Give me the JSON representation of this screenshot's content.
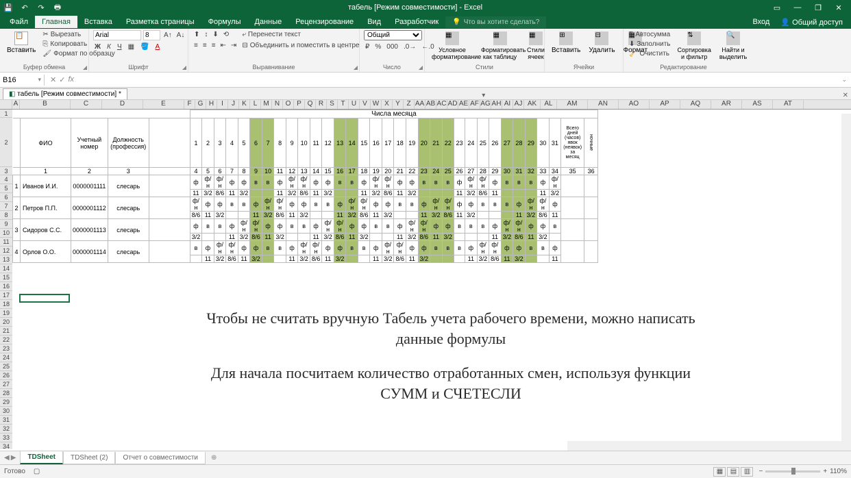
{
  "title": "табель [Режим совместимости] - Excel",
  "menu": {
    "file": "Файл",
    "tabs": [
      "Главная",
      "Вставка",
      "Разметка страницы",
      "Формулы",
      "Данные",
      "Рецензирование",
      "Вид",
      "Разработчик"
    ],
    "tell_me": "Что вы хотите сделать?",
    "login": "Вход",
    "share": "Общий доступ"
  },
  "ribbon": {
    "clipboard": {
      "label": "Буфер обмена",
      "paste": "Вставить",
      "cut": "Вырезать",
      "copy": "Копировать",
      "format_painter": "Формат по образцу"
    },
    "font": {
      "label": "Шрифт",
      "name": "Arial",
      "size": "8"
    },
    "alignment": {
      "label": "Выравнивание",
      "wrap": "Перенести текст",
      "merge": "Объединить и поместить в центре"
    },
    "number": {
      "label": "Число",
      "format": "Общий"
    },
    "styles": {
      "label": "Стили",
      "cond": "Условное форматирование",
      "table": "Форматировать как таблицу",
      "cell": "Стили ячеек"
    },
    "cells": {
      "label": "Ячейки",
      "insert": "Вставить",
      "delete": "Удалить",
      "format": "Формат"
    },
    "editing": {
      "label": "Редактирование",
      "autosum": "Автосумма",
      "fill": "Заполнить",
      "clear": "Очистить",
      "sort": "Сортировка и фильтр",
      "find": "Найти и выделить"
    }
  },
  "namebox": "B16",
  "formula": "",
  "doc_tab": "табель [Режим совместимости]",
  "columns_main": [
    "A",
    "B",
    "C",
    "D",
    "E"
  ],
  "columns_days": [
    "F",
    "G",
    "H",
    "I",
    "J",
    "K",
    "L",
    "M",
    "N",
    "O",
    "P",
    "Q",
    "R",
    "S",
    "T",
    "U",
    "V",
    "W",
    "X",
    "Y",
    "Z",
    "AA",
    "AB",
    "AC",
    "AD",
    "AE",
    "AF",
    "AG",
    "AH",
    "AI",
    "AJ"
  ],
  "columns_extra": [
    "AK",
    "AL",
    "AM",
    "AN",
    "AO",
    "AP",
    "AQ",
    "AR",
    "AS",
    "AT"
  ],
  "row_numbers": [
    "1",
    "2",
    "3",
    "4",
    "5",
    "6",
    "7",
    "8",
    "9",
    "10",
    "11",
    "12",
    "13",
    "14",
    "15",
    "16",
    "17",
    "18",
    "19",
    "20",
    "21",
    "22",
    "23",
    "24",
    "25",
    "26",
    "27",
    "28",
    "29",
    "30",
    "31",
    "32",
    "33",
    "34"
  ],
  "table": {
    "title_days": "Числа месяца",
    "headers": {
      "fio": "ФИО",
      "num": "Учетный номер",
      "pos": "Должность (профессия)",
      "total": "Всего дней (часов) явок (неявок) за месяц",
      "night": "ночные"
    },
    "days": [
      "1",
      "2",
      "3",
      "4",
      "5",
      "6",
      "7",
      "8",
      "9",
      "10",
      "11",
      "12",
      "13",
      "14",
      "15",
      "16",
      "17",
      "18",
      "19",
      "20",
      "21",
      "22",
      "23",
      "24",
      "25",
      "26",
      "27",
      "28",
      "29",
      "30",
      "31"
    ],
    "idx_row": [
      "1",
      "2",
      "3",
      "4",
      "5",
      "6",
      "7",
      "8",
      "9",
      "10",
      "11",
      "12",
      "13",
      "14",
      "15",
      "16",
      "17",
      "18",
      "19",
      "20",
      "21",
      "22",
      "23",
      "24",
      "25",
      "26",
      "27",
      "28",
      "29",
      "30",
      "31",
      "32",
      "33",
      "34",
      "35",
      "36"
    ],
    "weekend_days": [
      6,
      7,
      13,
      14,
      20,
      21,
      22,
      27,
      28,
      29
    ],
    "employees": [
      {
        "n": "1",
        "fio": "Иванов И.И.",
        "num": "0000001111",
        "pos": "слесарь",
        "r1": [
          "ф",
          "ф/н",
          "ф/н",
          "ф",
          "ф",
          "в",
          "в",
          "ф",
          "ф/н",
          "ф/н",
          "ф",
          "ф",
          "в",
          "в",
          "ф",
          "ф/н",
          "ф/н",
          "ф",
          "ф",
          "в",
          "в",
          "в",
          "ф",
          "ф/н",
          "ф/н",
          "ф",
          "в",
          "в",
          "в",
          "ф",
          "ф/н"
        ],
        "r2": [
          "11",
          "3/2",
          "8/6",
          "11",
          "3/2",
          "",
          "",
          "11",
          "3/2",
          "8/6",
          "11",
          "3/2",
          "",
          "",
          "11",
          "3/2",
          "8/6",
          "11",
          "3/2",
          "",
          "",
          "",
          "11",
          "3/2",
          "8/6",
          "11",
          "",
          "",
          "",
          "11",
          "3/2"
        ]
      },
      {
        "n": "2",
        "fio": "Петров П.П.",
        "num": "0000001112",
        "pos": "слесарь",
        "r1": [
          "ф/н",
          "ф",
          "ф",
          "в",
          "в",
          "ф",
          "ф/н",
          "ф/н",
          "ф",
          "ф",
          "в",
          "в",
          "ф",
          "ф/н",
          "ф/н",
          "ф",
          "ф",
          "в",
          "в",
          "ф",
          "ф/н",
          "ф/н",
          "ф",
          "ф",
          "в",
          "в",
          "в",
          "ф",
          "ф/н",
          "ф/н",
          "ф"
        ],
        "r2": [
          "8/6",
          "11",
          "3/2",
          "",
          "",
          "11",
          "3/2",
          "8/6",
          "11",
          "3/2",
          "",
          "",
          "11",
          "3/2",
          "8/6",
          "11",
          "3/2",
          "",
          "",
          "11",
          "3/2",
          "8/6",
          "11",
          "3/2",
          "",
          "",
          "",
          "11",
          "3/2",
          "8/6",
          "11"
        ]
      },
      {
        "n": "3",
        "fio": "Сидоров С.С.",
        "num": "0000001113",
        "pos": "слесарь",
        "r1": [
          "ф",
          "в",
          "в",
          "ф",
          "ф/н",
          "ф/н",
          "ф",
          "ф",
          "в",
          "в",
          "ф",
          "ф/н",
          "ф/н",
          "ф",
          "ф",
          "в",
          "в",
          "ф",
          "ф/н",
          "ф/н",
          "ф",
          "ф",
          "в",
          "в",
          "в",
          "ф",
          "ф/н",
          "ф/н",
          "ф",
          "ф",
          "в"
        ],
        "r2": [
          "3/2",
          "",
          "",
          "11",
          "3/2",
          "8/6",
          "11",
          "3/2",
          "",
          "",
          "11",
          "3/2",
          "8/6",
          "11",
          "3/2",
          "",
          "",
          "11",
          "3/2",
          "8/6",
          "11",
          "3/2",
          "",
          "",
          "",
          "11",
          "3/2",
          "8/6",
          "11",
          "3/2",
          ""
        ]
      },
      {
        "n": "4",
        "fio": "Орлов О.О.",
        "num": "0000001114",
        "pos": "слесарь",
        "r1": [
          "в",
          "ф",
          "ф/н",
          "ф/н",
          "ф",
          "ф",
          "в",
          "в",
          "ф",
          "ф/н",
          "ф/н",
          "ф",
          "ф",
          "в",
          "в",
          "ф",
          "ф/н",
          "ф/н",
          "ф",
          "ф",
          "в",
          "в",
          "в",
          "ф",
          "ф/н",
          "ф/н",
          "ф",
          "ф",
          "в",
          "в",
          "ф"
        ],
        "r2": [
          "",
          "11",
          "3/2",
          "8/6",
          "11",
          "3/2",
          "",
          "",
          "11",
          "3/2",
          "8/6",
          "11",
          "3/2",
          "",
          "",
          "11",
          "3/2",
          "8/6",
          "11",
          "3/2",
          "",
          "",
          "",
          "11",
          "3/2",
          "8/6",
          "11",
          "3/2",
          "",
          "",
          "11"
        ]
      }
    ]
  },
  "overlay": {
    "p1": "Чтобы не считать вручную Табель учета рабочего времени, можно написать данные формулы",
    "p2": "Для начала посчитаем количество отработанных смен, используя функции СУММ и СЧЕТЕСЛИ"
  },
  "sheets": {
    "s1": "TDSheet",
    "s2": "TDSheet (2)",
    "s3": "Отчет о совместимости"
  },
  "status": {
    "ready": "Готово",
    "zoom": "110%"
  }
}
